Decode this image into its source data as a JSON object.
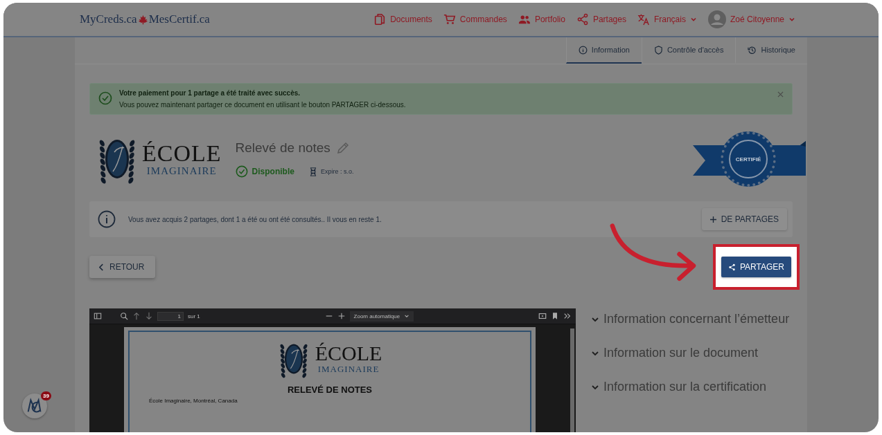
{
  "header": {
    "logo_left": "MyCreds.ca",
    "logo_right": "MesCertif.ca",
    "nav": [
      {
        "kind": "documents",
        "label": "Documents",
        "dropdown": false
      },
      {
        "kind": "cart",
        "label": "Commandes",
        "dropdown": false
      },
      {
        "kind": "people",
        "label": "Portfolio",
        "dropdown": false
      },
      {
        "kind": "share",
        "label": "Partages",
        "dropdown": false
      },
      {
        "kind": "language",
        "label": "Français",
        "dropdown": true
      },
      {
        "kind": "avatar",
        "label": "Zoé Citoyenne",
        "dropdown": true
      }
    ]
  },
  "tabs": [
    {
      "kind": "info",
      "label": "Information",
      "selected": true
    },
    {
      "kind": "shield",
      "label": "Contrôle d'accès",
      "selected": false
    },
    {
      "kind": "history",
      "label": "Historique",
      "selected": false
    }
  ],
  "alert": {
    "title": "Votre paiement pour 1 partage a été traité avec succès.",
    "message": "Vous pouvez maintenant partager ce document en utilisant le bouton PARTAGER ci-dessous."
  },
  "document": {
    "school_name": "ÉCOLE",
    "school_subtitle": "IMAGINAIRE",
    "title": "Relevé de notes",
    "status": "Disponible",
    "expiry": "Expire : s.o.",
    "badge": "CERTIFIÉ"
  },
  "info_bar": {
    "message": "Vous avez acquis 2 partages, dont 1 a été ou ont été consultés.. Il vous en reste 1.",
    "button": "DE PARTAGES"
  },
  "back_button": "RETOUR",
  "share_button": {
    "label": "PARTAGER",
    "highlighted": true
  },
  "pdf_viewer": {
    "page": "1",
    "page_total": "sur 1",
    "zoom": "Zoom automatique",
    "school_name": "ÉCOLE",
    "school_subtitle": "IMAGINAIRE",
    "heading": "RELEVÉ DE NOTES",
    "address": "École Imaginaire, Montréal, Canada"
  },
  "accordion": [
    {
      "label": "Information concernant l’émetteur",
      "expanded": false
    },
    {
      "label": "Information sur le document",
      "expanded": false
    },
    {
      "label": "Information sur la certification",
      "expanded": false
    }
  ],
  "floating_badge": {
    "count": "39"
  }
}
